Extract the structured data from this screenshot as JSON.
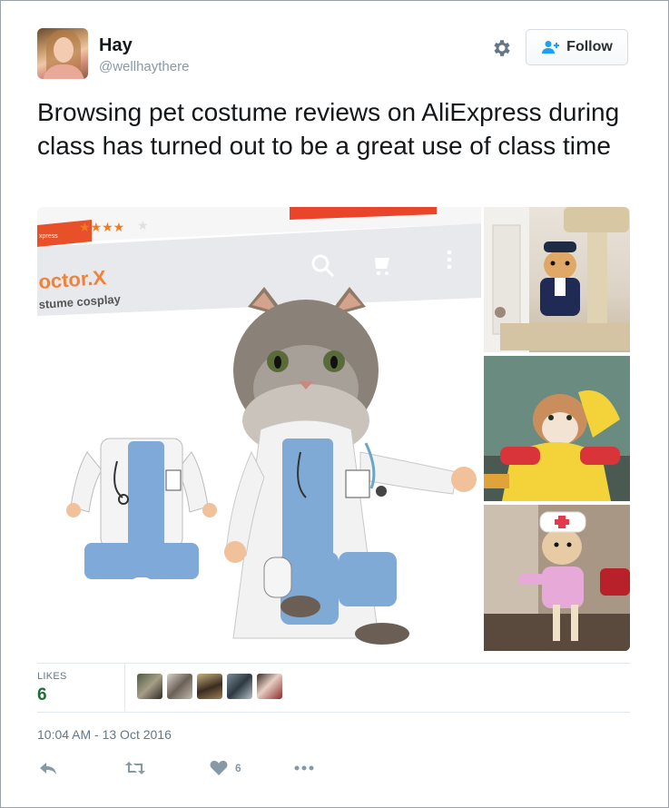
{
  "user": {
    "name": "Hay",
    "handle": "@wellhaythere"
  },
  "follow_button": {
    "label": "Follow"
  },
  "tweet": {
    "text": "Browsing pet costume reviews on AliExpress during class has turned out to be a great use of class time",
    "timestamp": "10:04 AM - 13 Oct 2016"
  },
  "media": {
    "main": {
      "brand_text": "octor.X",
      "sub_text": "stume cosplay",
      "store_text": "xpress",
      "stars": "★★★★"
    }
  },
  "stats": {
    "likes_label": "LIKES",
    "likes_count": "6",
    "liker_count": 5
  },
  "actions": {
    "like_count": "6"
  },
  "colors": {
    "likes_green": "#1f6b3a",
    "follow_icon": "#1da1f2",
    "icon_gray": "#8899a6"
  },
  "icons": [
    "gear-icon",
    "follow-person-icon",
    "reply-icon",
    "retweet-icon",
    "heart-icon",
    "more-icon"
  ]
}
